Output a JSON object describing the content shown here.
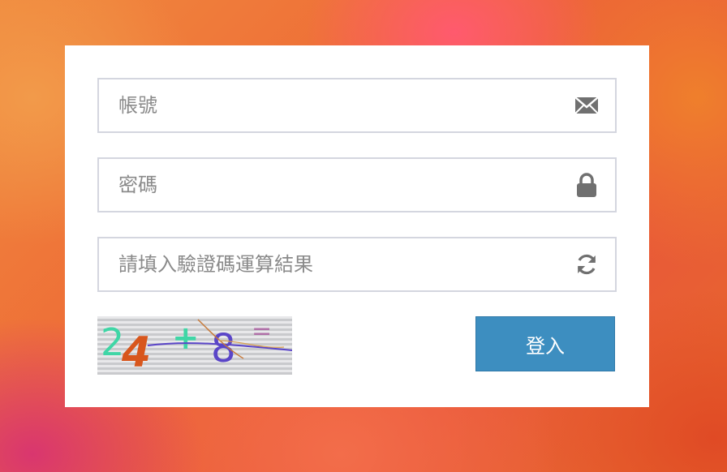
{
  "login": {
    "account_placeholder": "帳號",
    "account_icon": "envelope-icon",
    "password_placeholder": "密碼",
    "password_icon": "lock-icon",
    "captcha_placeholder": "請填入驗證碼運算結果",
    "captcha_refresh_icon": "refresh-icon",
    "captcha_text": "24+8=",
    "submit_label": "登入"
  },
  "colors": {
    "button_bg": "#3d8ec0",
    "field_border": "#d4d6df",
    "placeholder": "#8a8a8a",
    "icon": "#707070"
  }
}
